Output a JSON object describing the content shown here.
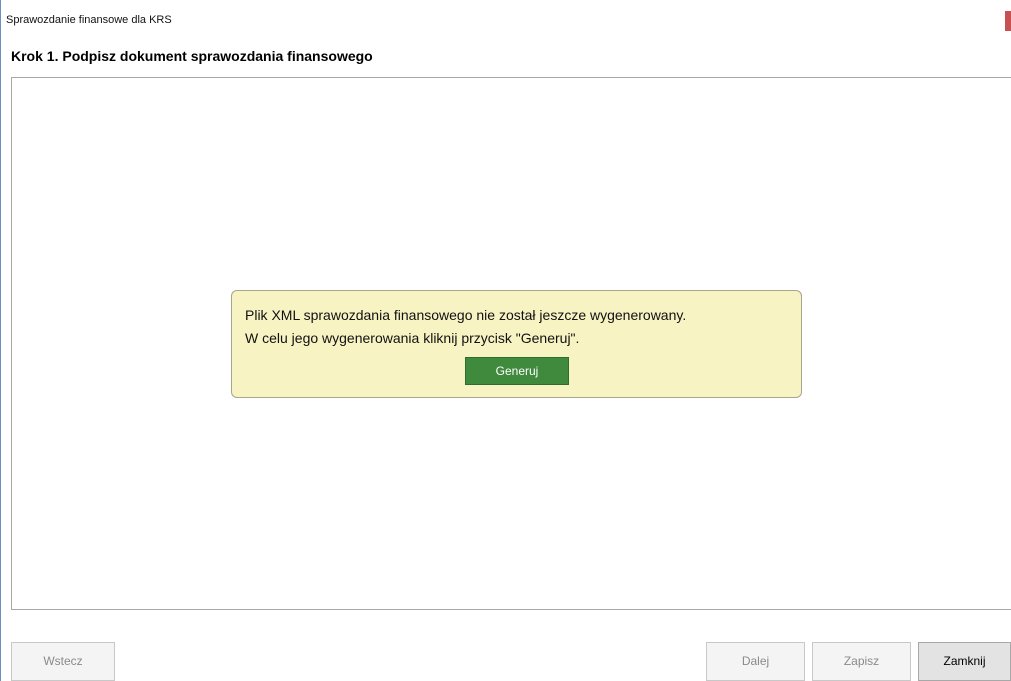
{
  "window": {
    "title": "Sprawozdanie finansowe dla KRS"
  },
  "step": {
    "title": "Krok 1. Podpisz dokument sprawozdania finansowego"
  },
  "notice": {
    "line1": "Plik XML sprawozdania finansowego nie został jeszcze wygenerowany.",
    "line2": "W celu jego wygenerowania kliknij przycisk \"Generuj\".",
    "button_label": "Generuj"
  },
  "footer": {
    "back_label": "Wstecz",
    "next_label": "Dalej",
    "save_label": "Zapisz",
    "close_label": "Zamknij"
  },
  "colors": {
    "notice_background": "#f7f3c3",
    "generate_button": "#3f8a3d",
    "close_accent": "#c75050"
  }
}
